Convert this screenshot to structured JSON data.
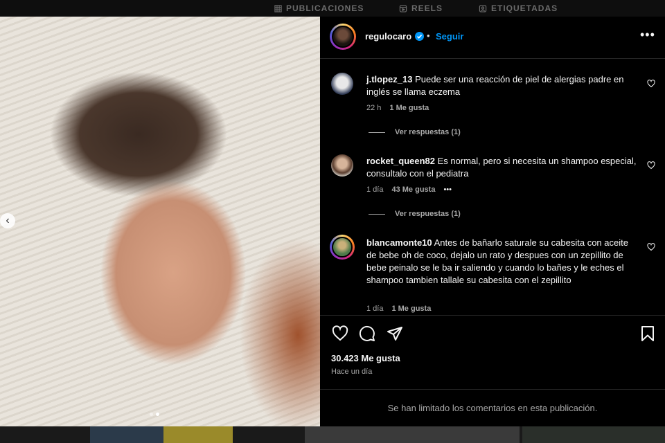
{
  "profile_tabs": [
    {
      "label": "PUBLICACIONES",
      "icon": "grid-icon"
    },
    {
      "label": "REELS",
      "icon": "reels-icon"
    },
    {
      "label": "ETIQUETADAS",
      "icon": "tagged-icon"
    }
  ],
  "post": {
    "username": "regulocaro",
    "verified": true,
    "separator": "•",
    "follow_label": "Seguir",
    "more_label": "•••",
    "likes": "30.423 Me gusta",
    "time": "Hace un día",
    "comments_limited": "Se han limitado los comentarios en esta publicación."
  },
  "carousel": {
    "prev_label": "‹",
    "slide_count": 2,
    "active_slide": 2
  },
  "comments": [
    {
      "username": "j.tlopez_13",
      "text": "Puede ser una reacción de piel de alergias padre en inglés se llama eczema",
      "age": "22 h",
      "likes": "1 Me gusta",
      "replies": "Ver respuestas (1)"
    },
    {
      "username": "rocket_queen82",
      "text": "Es normal, pero si necesita un shampoo especial, consultalo con el pediatra",
      "age": "1 día",
      "likes": "43 Me gusta",
      "options": "•••",
      "replies": "Ver respuestas (1)"
    },
    {
      "username": "blancamonte10",
      "text": "Antes de bañarlo saturale su cabesita con aceite de bebe oh de coco, dejalo un rato y despues con un zepillito de bebe peinalo se le ba ir saliendo y cuando lo bañes y le eches el shampoo tambien tallale su cabesita con el zepillito",
      "age": "1 día",
      "likes": "1 Me gusta"
    }
  ],
  "colors": {
    "accent": "#0095f6",
    "background": "#000000",
    "muted": "#a8a8a8"
  }
}
